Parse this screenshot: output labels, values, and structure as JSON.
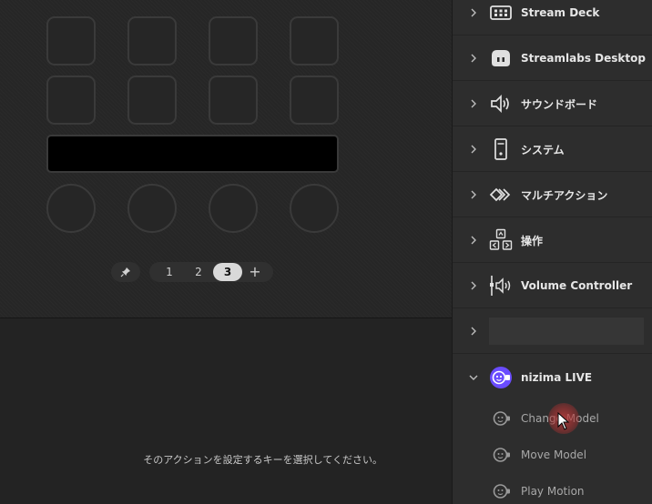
{
  "deck": {
    "pages": [
      "1",
      "2",
      "3"
    ],
    "active_page": "3",
    "add_page_symbol": "+",
    "hint_text": "そのアクションを設定するキーを選択してください。"
  },
  "categories": [
    {
      "label": "Stream Deck",
      "icon": "stream-deck-icon"
    },
    {
      "label": "Streamlabs Desktop",
      "icon": "streamlabs-icon"
    },
    {
      "label": "サウンドボード",
      "icon": "speaker-icon"
    },
    {
      "label": "システム",
      "icon": "system-tower-icon"
    },
    {
      "label": "マルチアクション",
      "icon": "multi-action-icon"
    },
    {
      "label": "操作",
      "icon": "arrow-keys-icon"
    },
    {
      "label": "Volume Controller",
      "icon": "volume-controller-icon"
    },
    {
      "label": "",
      "icon": ""
    },
    {
      "label": "nizima LIVE",
      "icon": "nizima-live-icon",
      "expanded": true
    }
  ],
  "actions": [
    {
      "label": "Change Model",
      "icon": "model-face-icon"
    },
    {
      "label": "Move Model",
      "icon": "model-face-icon"
    },
    {
      "label": "Play Motion",
      "icon": "model-face-icon"
    }
  ],
  "colors": {
    "accent_nizima": "#6a4cff",
    "active_page_bg": "#d9d9d9",
    "cursor_highlight": "#c04040"
  }
}
